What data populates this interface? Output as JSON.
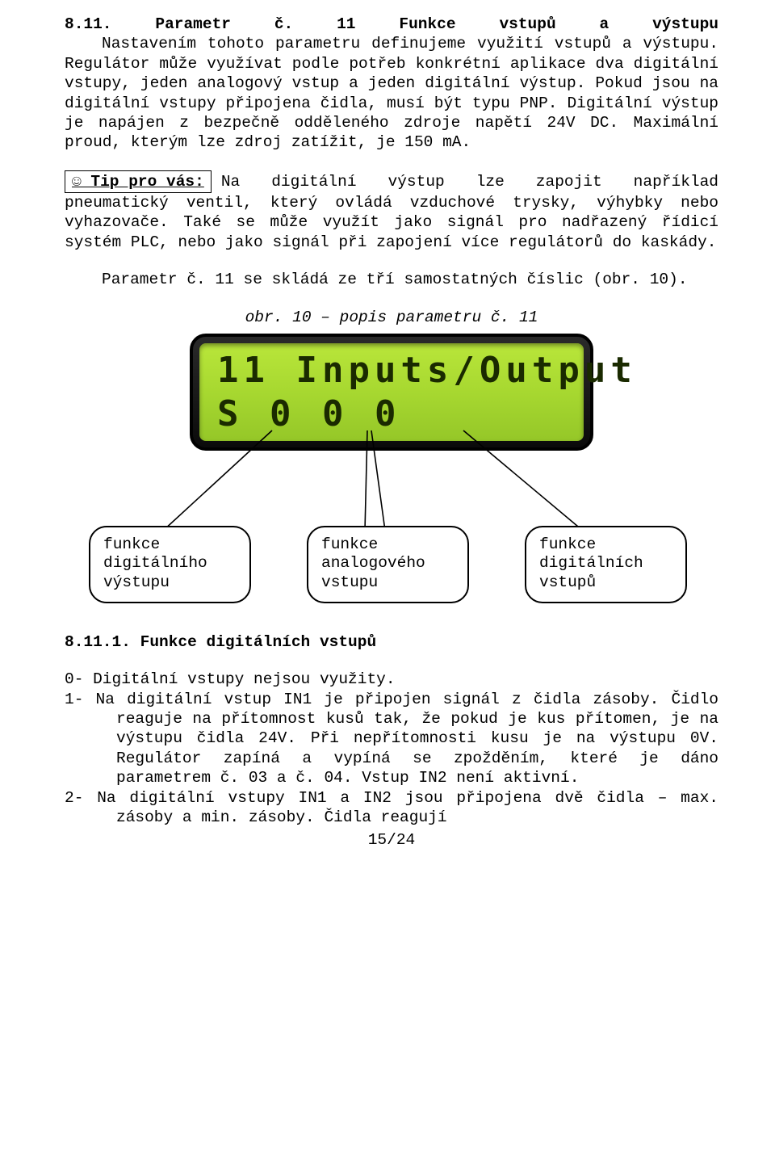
{
  "heading_line1": "8.11. Parametr č. 11 Funkce vstupů a výstupu",
  "para1": "Nastavením tohoto parametru definujeme využití vstupů a výstupu. Regulátor může využívat podle potřeb konkrétní aplikace dva digitální vstupy, jeden analogový vstup a jeden digitální výstup. Pokud jsou na digitální vstupy připojena čidla, musí být typu PNP. Digitální výstup je napájen z bezpečně odděleného zdroje napětí 24V DC. Maximální proud, kterým lze zdroj zatížit, je 150 mA.",
  "tip_label": "☺ Tip pro vás:",
  "tip_text": "Na digitální výstup lze zapojit například pneumatický ventil, který ovládá vzduchové trysky, výhybky nebo vyhazovače. Také se může využít jako signál pro nadřazený řídicí systém PLC, nebo jako signál při zapojení více regulátorů do kaskády.",
  "param_line": "Parametr č. 11 se skládá ze tří samostatných číslic (obr. 10).",
  "caption": "obr. 10 – popis parametru č. 11",
  "lcd": {
    "line1": "11 Inputs/Output",
    "line2": "S  0  0  0"
  },
  "labels": {
    "l1": "funkce digitálního výstupu",
    "l2": "funkce analogového vstupu",
    "l3": "funkce digitálních vstupů"
  },
  "subheading": "8.11.1. Funkce digitálních vstupů",
  "items": [
    {
      "num": "0-",
      "text": "Digitální vstupy nejsou využity."
    },
    {
      "num": "1-",
      "text": "Na digitální vstup IN1 je připojen signál z čidla zásoby. Čidlo reaguje na přítomnost kusů tak, že pokud je kus přítomen, je na výstupu čidla 24V. Při nepřítomnosti kusu je na výstupu 0V. Regulátor zapíná a vypíná se zpožděním, které je dáno parametrem č. 03 a č. 04. Vstup IN2 není aktivní."
    },
    {
      "num": "2-",
      "text": "Na digitální vstupy IN1 a IN2 jsou připojena dvě čidla – max. zásoby a min. zásoby. Čidla reagují"
    }
  ],
  "footer": "15/24"
}
